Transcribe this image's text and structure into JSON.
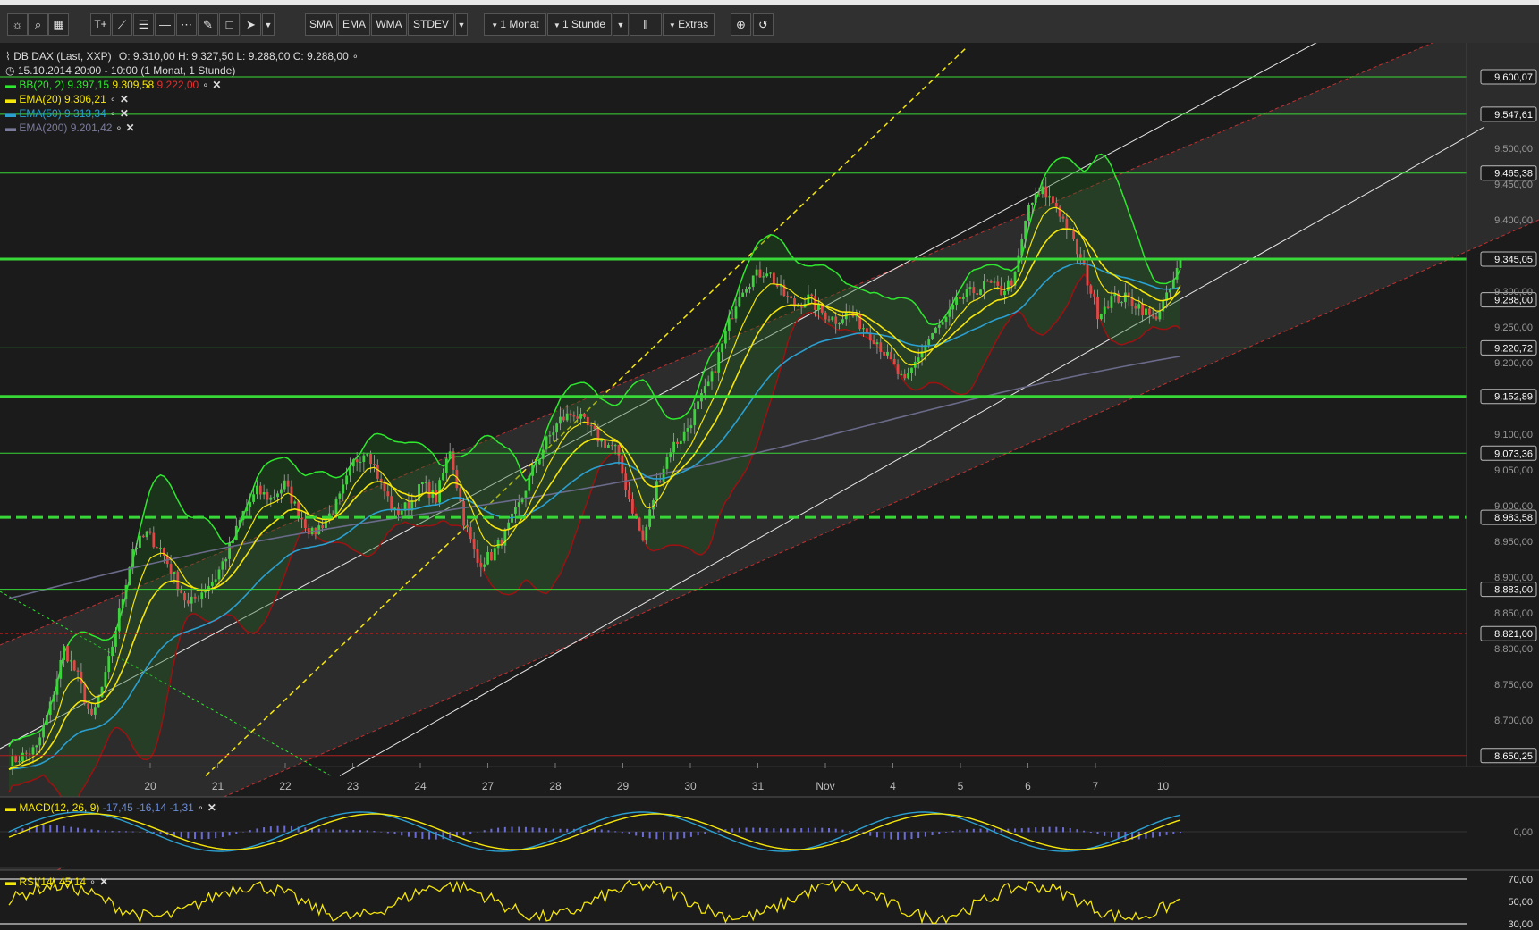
{
  "toolbar": {
    "icons": [
      "sun-icon",
      "search-icon",
      "grid-icon",
      "text-tool-icon",
      "trendline-icon",
      "fibonacci-icon",
      "horizontal-line-icon",
      "channel-icon",
      "pen-icon",
      "rectangle-icon",
      "arrow-icon",
      "chevron-down-icon",
      "zoom-in-icon",
      "undo-icon"
    ],
    "text_tool_label": "T+",
    "sma": "SMA",
    "ema": "EMA",
    "wma": "WMA",
    "stdev": "STDEV",
    "period": "1 Monat",
    "interval": "1 Stunde",
    "extras": "Extras"
  },
  "legend": {
    "instrument": "DB DAX (Last, XXP)",
    "ohlc": "O: 9.310,00  H: 9.327,50  L: 9.288,00  C: 9.288,00",
    "range": "15.10.2014 20:00 - 10:00 (1 Monat, 1 Stunde)",
    "bb": {
      "label": "BB(20, 2)",
      "upper": "9.397,15",
      "middle": "9.309,58",
      "lower": "9.222,00"
    },
    "ema20": {
      "label": "EMA(20)",
      "value": "9.306,21"
    },
    "ema50": {
      "label": "EMA(50)",
      "value": "9.313,34"
    },
    "ema200": {
      "label": "EMA(200)",
      "value": "9.201,42"
    },
    "macd": {
      "label": "MACD(12, 26, 9)",
      "values": "-17,45  -16,14  -1,31"
    },
    "rsi": {
      "label": "RSI(14)",
      "value": "45,14"
    }
  },
  "colors": {
    "background": "#1b1b1b",
    "bb_band": "#2ee82e",
    "bb_lower": "#9c1212",
    "ema20": "#f5e60a",
    "ema50": "#2a9fd0",
    "ema200": "#6a6a8a",
    "level": "#38d838",
    "level_red": "#b02020",
    "bull": "#3fd23f",
    "bear": "#e04848",
    "macd_hist": "#6b6bd6"
  },
  "chart_data": {
    "type": "line",
    "title": "DB DAX (Last, XXP)",
    "x_ticks": [
      "20",
      "21",
      "22",
      "23",
      "24",
      "27",
      "28",
      "29",
      "30",
      "31",
      "Nov",
      "4",
      "5",
      "6",
      "7",
      "10"
    ],
    "y_ticks": [
      "9.500,00",
      "9.450,00",
      "9.400,00",
      "9.300,00",
      "9.250,00",
      "9.200,00",
      "9.100,00",
      "9.050,00",
      "9.000,00",
      "8.950,00",
      "8.900,00",
      "8.850,00",
      "8.800,00",
      "8.750,00",
      "8.700,00"
    ],
    "y_tick_values": [
      9500,
      9450,
      9400,
      9300,
      9250,
      9200,
      9100,
      9050,
      9000,
      8950,
      8900,
      8850,
      8800,
      8750,
      8700
    ],
    "ylim": [
      8640,
      9640
    ],
    "levels": [
      {
        "label": "9.600,07",
        "value": 9600.07,
        "style": "thin"
      },
      {
        "label": "9.547,61",
        "value": 9547.61,
        "style": "thin"
      },
      {
        "label": "9.465,38",
        "value": 9465.38,
        "style": "thin"
      },
      {
        "label": "9.345,05",
        "value": 9345.05,
        "style": "thick"
      },
      {
        "label": "9.288,00",
        "value": 9288.0,
        "style": "price"
      },
      {
        "label": "9.220,72",
        "value": 9220.72,
        "style": "thin"
      },
      {
        "label": "9.152,89",
        "value": 9152.89,
        "style": "thick"
      },
      {
        "label": "9.073,36",
        "value": 9073.36,
        "style": "thin"
      },
      {
        "label": "8.983,58",
        "value": 8983.58,
        "style": "dashed"
      },
      {
        "label": "8.883,00",
        "value": 8883.0,
        "style": "thin"
      },
      {
        "label": "8.821,00",
        "value": 8821.0,
        "style": "reddash"
      },
      {
        "label": "8.650,25",
        "value": 8650.25,
        "style": "red"
      }
    ],
    "price_path": [
      [
        0,
        8640
      ],
      [
        4,
        8660
      ],
      [
        6,
        8720
      ],
      [
        8,
        8800
      ],
      [
        10,
        8760
      ],
      [
        12,
        8700
      ],
      [
        14,
        8760
      ],
      [
        16,
        8850
      ],
      [
        18,
        8940
      ],
      [
        20,
        8960
      ],
      [
        22,
        8940
      ],
      [
        24,
        8900
      ],
      [
        26,
        8860
      ],
      [
        28,
        8880
      ],
      [
        30,
        8900
      ],
      [
        32,
        8940
      ],
      [
        34,
        8990
      ],
      [
        36,
        9020
      ],
      [
        38,
        9010
      ],
      [
        40,
        9030
      ],
      [
        42,
        8990
      ],
      [
        44,
        8960
      ],
      [
        46,
        8980
      ],
      [
        48,
        9010
      ],
      [
        50,
        9060
      ],
      [
        52,
        9080
      ],
      [
        54,
        9030
      ],
      [
        56,
        8990
      ],
      [
        58,
        9000
      ],
      [
        60,
        9030
      ],
      [
        62,
        9010
      ],
      [
        64,
        9080
      ],
      [
        66,
        8980
      ],
      [
        68,
        8920
      ],
      [
        70,
        8930
      ],
      [
        72,
        8960
      ],
      [
        74,
        9000
      ],
      [
        76,
        9050
      ],
      [
        78,
        9090
      ],
      [
        80,
        9120
      ],
      [
        82,
        9130
      ],
      [
        84,
        9110
      ],
      [
        86,
        9090
      ],
      [
        88,
        9080
      ],
      [
        90,
        9010
      ],
      [
        92,
        8950
      ],
      [
        94,
        9030
      ],
      [
        96,
        9080
      ],
      [
        98,
        9100
      ],
      [
        100,
        9140
      ],
      [
        102,
        9180
      ],
      [
        104,
        9240
      ],
      [
        106,
        9300
      ],
      [
        108,
        9320
      ],
      [
        110,
        9330
      ],
      [
        112,
        9300
      ],
      [
        114,
        9280
      ],
      [
        116,
        9290
      ],
      [
        118,
        9270
      ],
      [
        120,
        9260
      ],
      [
        122,
        9270
      ],
      [
        124,
        9250
      ],
      [
        126,
        9230
      ],
      [
        128,
        9200
      ],
      [
        130,
        9170
      ],
      [
        132,
        9210
      ],
      [
        134,
        9240
      ],
      [
        136,
        9260
      ],
      [
        138,
        9290
      ],
      [
        140,
        9300
      ],
      [
        142,
        9310
      ],
      [
        144,
        9300
      ],
      [
        146,
        9320
      ],
      [
        148,
        9420
      ],
      [
        150,
        9440
      ],
      [
        152,
        9420
      ],
      [
        154,
        9380
      ],
      [
        156,
        9330
      ],
      [
        158,
        9270
      ],
      [
        160,
        9290
      ],
      [
        162,
        9290
      ],
      [
        164,
        9280
      ],
      [
        166,
        9260
      ],
      [
        168,
        9290
      ],
      [
        170,
        9340
      ]
    ]
  }
}
